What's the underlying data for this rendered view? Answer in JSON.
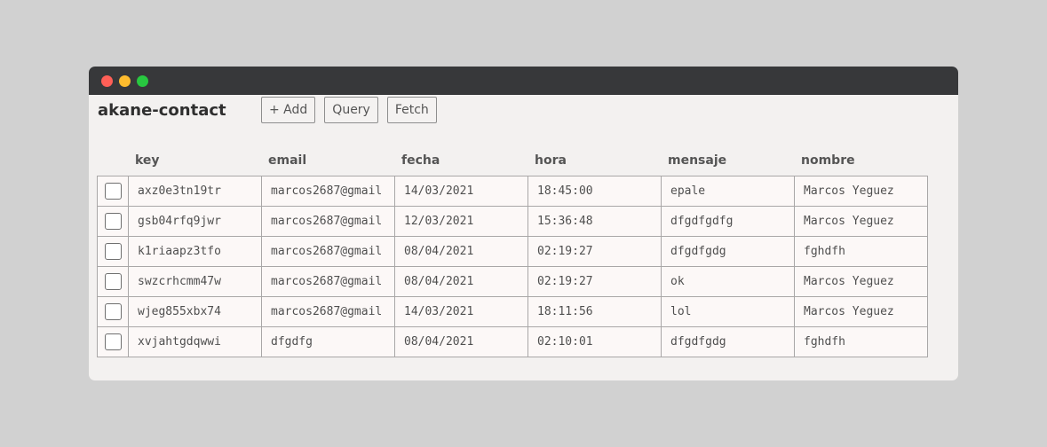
{
  "window": {
    "colors": {
      "close": "#ff5f57",
      "minimize": "#febc2e",
      "maximize": "#28c840"
    }
  },
  "app": {
    "title": "akane-contact"
  },
  "toolbar": {
    "add_label": "+ Add",
    "query_label": "Query",
    "fetch_label": "Fetch"
  },
  "table": {
    "columns": [
      "key",
      "email",
      "fecha",
      "hora",
      "mensaje",
      "nombre"
    ],
    "rows": [
      [
        "axz0e3tn19tr",
        "marcos2687@gmail",
        "14/03/2021",
        "18:45:00",
        "epale",
        "Marcos Yeguez"
      ],
      [
        "gsb04rfq9jwr",
        "marcos2687@gmail",
        "12/03/2021",
        "15:36:48",
        "dfgdfgdfg",
        "Marcos Yeguez"
      ],
      [
        "k1riaapz3tfo",
        "marcos2687@gmail",
        "08/04/2021",
        "02:19:27",
        "dfgdfgdg",
        "fghdfh"
      ],
      [
        "swzcrhcmm47w",
        "marcos2687@gmail",
        "08/04/2021",
        "02:19:27",
        "ok",
        "Marcos Yeguez"
      ],
      [
        "wjeg855xbx74",
        "marcos2687@gmail",
        "14/03/2021",
        "18:11:56",
        "lol",
        "Marcos Yeguez"
      ],
      [
        "xvjahtgdqwwi",
        "dfgdfg",
        "08/04/2021",
        "02:10:01",
        "dfgdfgdg",
        "fghdfh"
      ]
    ]
  }
}
